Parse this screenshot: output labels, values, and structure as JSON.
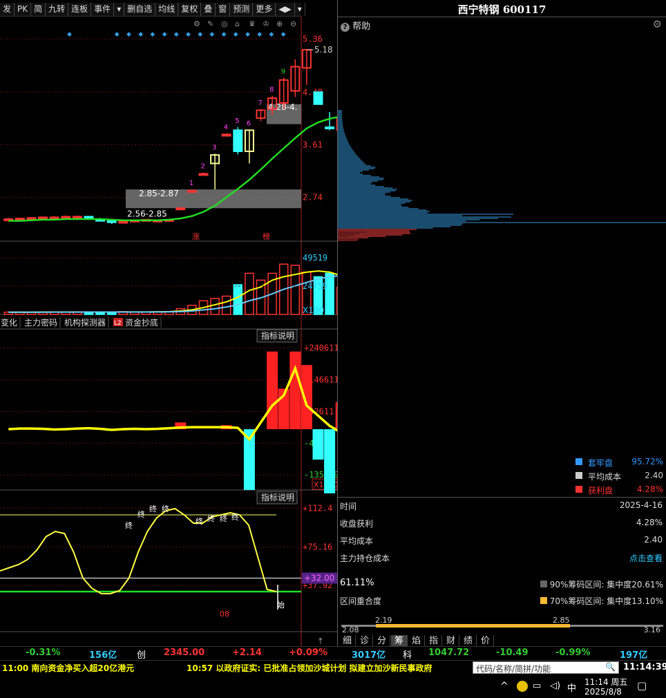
{
  "toolbar": {
    "items": [
      "发",
      "PK",
      "简",
      "九转",
      "连板",
      "事件",
      "▾",
      "删自选",
      "均线",
      "复权",
      "叠",
      "窗",
      "预测",
      "更多",
      "◀▶",
      "▾"
    ]
  },
  "stock": {
    "name": "西宁特钢",
    "code": "600117"
  },
  "help": {
    "label": "帮助"
  },
  "price_axis": [
    "5.36",
    "4.48",
    "3.61",
    "2.74"
  ],
  "price_annotations": {
    "high": "5.18",
    "gap_upper": "4.28-4.",
    "gap_mid": "2.85-2.87",
    "gap_lower": "2.56-2.85"
  },
  "sequence_numbers": [
    "1",
    "2",
    "3",
    "4",
    "5",
    "6",
    "7",
    "8",
    "9"
  ],
  "markers": {
    "zhang": "涨",
    "bang": "榜"
  },
  "volume_axis": [
    "49519",
    "24759",
    "X100"
  ],
  "indicator_tabs": [
    "变化",
    "主力密码",
    "机构探测器",
    "L2",
    "资金抄底"
  ],
  "indicator1": {
    "button": "指标说明",
    "axis": [
      "+240611",
      "+146611",
      "+52611",
      "-41389",
      "-135389",
      "X1000"
    ]
  },
  "indicator2": {
    "button": "指标说明",
    "axis": [
      "+112.4",
      "+75.16",
      "+37.92",
      "+32.00"
    ],
    "labels": [
      "终",
      "终",
      "终",
      "终",
      "终",
      "终",
      "终",
      "终",
      "始"
    ],
    "x_label": "08"
  },
  "chip": {
    "legend": [
      {
        "label": "套牢盘",
        "value": "95.72%",
        "color": "#3399ff"
      },
      {
        "label": "平均成本",
        "value": "2.40",
        "color": "#cccccc"
      },
      {
        "label": "获利盘",
        "value": "4.28%",
        "color": "#ff3333"
      }
    ],
    "rows": [
      {
        "label": "时间",
        "value": "2025-4-16"
      },
      {
        "label": "收盘获利",
        "value": "4.28%"
      },
      {
        "label": "平均成本",
        "value": "2.40"
      },
      {
        "label": "主力持仓成本",
        "value": "点击查看"
      }
    ],
    "overlap_pct": "61.11%",
    "overlap_label": "区间重合度",
    "range90": "90%筹码区间: 集中度20.61%",
    "range70": "70%筹码区间: 集中度13.10%",
    "bar_labels": {
      "low": "2.08",
      "v1": "2.19",
      "v2": "2.85",
      "high": "3.16"
    },
    "tabs": [
      "细",
      "诊",
      "分",
      "筹",
      "焰",
      "指",
      "财",
      "绩",
      "价"
    ]
  },
  "statusbar": {
    "sh_pct": "-0.31%",
    "sh_amt": "156亿",
    "cy_label": "创",
    "cy_index": "2345.00",
    "cy_chg": "+2.14",
    "cy_pct": "+0.09%",
    "cy_amt": "3017亿",
    "kc_label": "科",
    "kc_index": "1047.72",
    "kc_chg": "-10.49",
    "kc_pct": "-0.99%",
    "kc_amt": "197亿"
  },
  "news": {
    "item1": "11:00 南向资金净买入超20亿港元",
    "item2": "10:57 以政府证实: 已批准占领加沙城计划 拟建立加沙新民事政府",
    "search_placeholder": "代码/名称/简拼/功能",
    "clock": "11:14:39"
  },
  "taskbar": {
    "time": "11:14 周五",
    "date": "2025/8/8",
    "ime": "中"
  },
  "chart_data": [
    {
      "type": "candlestick",
      "title": "西宁特钢 600117",
      "ylim": [
        2.3,
        5.5
      ],
      "yticks": [
        5.36,
        4.48,
        3.61,
        2.74
      ],
      "candles": [
        {
          "o": 2.36,
          "c": 2.38,
          "h": 2.4,
          "l": 2.34
        },
        {
          "o": 2.37,
          "c": 2.39,
          "h": 2.4,
          "l": 2.35
        },
        {
          "o": 2.38,
          "c": 2.4,
          "h": 2.41,
          "l": 2.36
        },
        {
          "o": 2.39,
          "c": 2.41,
          "h": 2.42,
          "l": 2.37
        },
        {
          "o": 2.4,
          "c": 2.41,
          "h": 2.43,
          "l": 2.38
        },
        {
          "o": 2.4,
          "c": 2.42,
          "h": 2.44,
          "l": 2.39
        },
        {
          "o": 2.41,
          "c": 2.42,
          "h": 2.44,
          "l": 2.4
        },
        {
          "o": 2.42,
          "c": 2.4,
          "h": 2.43,
          "l": 2.38
        },
        {
          "o": 2.38,
          "c": 2.35,
          "h": 2.4,
          "l": 2.34
        },
        {
          "o": 2.35,
          "c": 2.33,
          "h": 2.36,
          "l": 2.3
        },
        {
          "o": 2.34,
          "c": 2.34,
          "h": 2.35,
          "l": 2.32
        },
        {
          "o": 2.35,
          "c": 2.36,
          "h": 2.37,
          "l": 2.34
        },
        {
          "o": 2.36,
          "c": 2.37,
          "h": 2.38,
          "l": 2.35
        },
        {
          "o": 2.36,
          "c": 2.36,
          "h": 2.37,
          "l": 2.35
        },
        {
          "o": 2.37,
          "c": 2.37,
          "h": 2.38,
          "l": 2.36
        },
        {
          "o": 2.56,
          "c": 2.56,
          "h": 2.58,
          "l": 2.55
        },
        {
          "o": 2.85,
          "c": 2.85,
          "h": 2.87,
          "l": 2.84
        },
        {
          "o": 3.13,
          "c": 3.13,
          "h": 3.15,
          "l": 3.12
        },
        {
          "o": 3.3,
          "c": 3.44,
          "h": 3.46,
          "l": 2.87
        },
        {
          "o": 3.78,
          "c": 3.78,
          "h": 3.8,
          "l": 3.77
        },
        {
          "o": 3.85,
          "c": 3.5,
          "h": 3.9,
          "l": 3.45
        },
        {
          "o": 3.5,
          "c": 3.85,
          "h": 3.86,
          "l": 3.3
        },
        {
          "o": 4.05,
          "c": 4.18,
          "h": 4.2,
          "l": 4.0
        },
        {
          "o": 4.2,
          "c": 4.38,
          "h": 4.42,
          "l": 4.1
        },
        {
          "o": 4.3,
          "c": 4.68,
          "h": 4.72,
          "l": 4.2
        },
        {
          "o": 4.5,
          "c": 4.9,
          "h": 5.02,
          "l": 4.4
        },
        {
          "o": 4.88,
          "c": 5.18,
          "h": 5.18,
          "l": 4.6
        },
        {
          "o": 4.48,
          "c": 4.28,
          "h": 4.48,
          "l": 4.28
        },
        {
          "o": 3.9,
          "c": 3.9,
          "h": 4.15,
          "l": 3.85
        },
        {
          "o": 3.85,
          "c": 4.05,
          "h": 4.08,
          "l": 3.75
        }
      ],
      "ma": [
        2.35,
        2.35,
        2.36,
        2.37,
        2.37,
        2.38,
        2.38,
        2.38,
        2.38,
        2.37,
        2.36,
        2.36,
        2.36,
        2.36,
        2.37,
        2.39,
        2.43,
        2.5,
        2.6,
        2.74,
        2.88,
        3.03,
        3.2,
        3.38,
        3.55,
        3.72,
        3.88,
        3.98,
        4.04,
        4.08
      ]
    },
    {
      "type": "bar",
      "title": "volume",
      "ylim": [
        0,
        55000
      ],
      "values": [
        2000,
        2100,
        1900,
        2200,
        2000,
        2100,
        2300,
        2200,
        2000,
        2100,
        2500,
        2200,
        2100,
        2400,
        2600,
        5000,
        8000,
        12000,
        14000,
        16000,
        26000,
        36000,
        30000,
        36000,
        44000,
        43000,
        37000,
        33000,
        36000,
        24000
      ],
      "ma5": [
        2000,
        2000,
        2000,
        2050,
        2100,
        2100,
        2100,
        2150,
        2150,
        2150,
        2200,
        2200,
        2200,
        2300,
        2400,
        3000,
        4000,
        6000,
        8500,
        11000,
        15000,
        21000,
        24000,
        30000,
        33000,
        35000,
        37000,
        38000,
        37000,
        34000
      ],
      "ma10": [
        2000,
        2000,
        2000,
        2000,
        2050,
        2050,
        2050,
        2100,
        2100,
        2100,
        2100,
        2150,
        2150,
        2200,
        2250,
        2500,
        3000,
        4000,
        5000,
        6500,
        8500,
        12000,
        14500,
        18000,
        22000,
        25000,
        28000,
        31000,
        33000,
        34000
      ]
    },
    {
      "type": "bar",
      "title": "资金抄底",
      "ylim": [
        -180000,
        260000
      ],
      "values": [
        0,
        0,
        0,
        0,
        0,
        0,
        0,
        0,
        0,
        -5000,
        0,
        0,
        0,
        0,
        0,
        20000,
        0,
        0,
        0,
        12000,
        0,
        -180000,
        0,
        230000,
        120000,
        230000,
        190000,
        -90000,
        -190000,
        80000
      ],
      "line": [
        0,
        2000,
        2000,
        1000,
        -1000,
        0,
        2000,
        3000,
        1000,
        -2000,
        0,
        1000,
        0,
        1000,
        3000,
        5000,
        6000,
        6000,
        6000,
        6000,
        4000,
        -30000,
        20000,
        70000,
        100000,
        180000,
        70000,
        40000,
        10000,
        -10000
      ]
    },
    {
      "type": "line",
      "title": "KDJ-like",
      "ylim": [
        10,
        120
      ],
      "yticks": [
        112.4,
        75.16,
        37.92,
        32.0
      ],
      "values": [
        52,
        55,
        58,
        63,
        72,
        85,
        90,
        88,
        70,
        45,
        35,
        30,
        30,
        33,
        45,
        70,
        90,
        103,
        110,
        112,
        106,
        98,
        98,
        104,
        106,
        108,
        106,
        96,
        65,
        34,
        32
      ]
    }
  ]
}
